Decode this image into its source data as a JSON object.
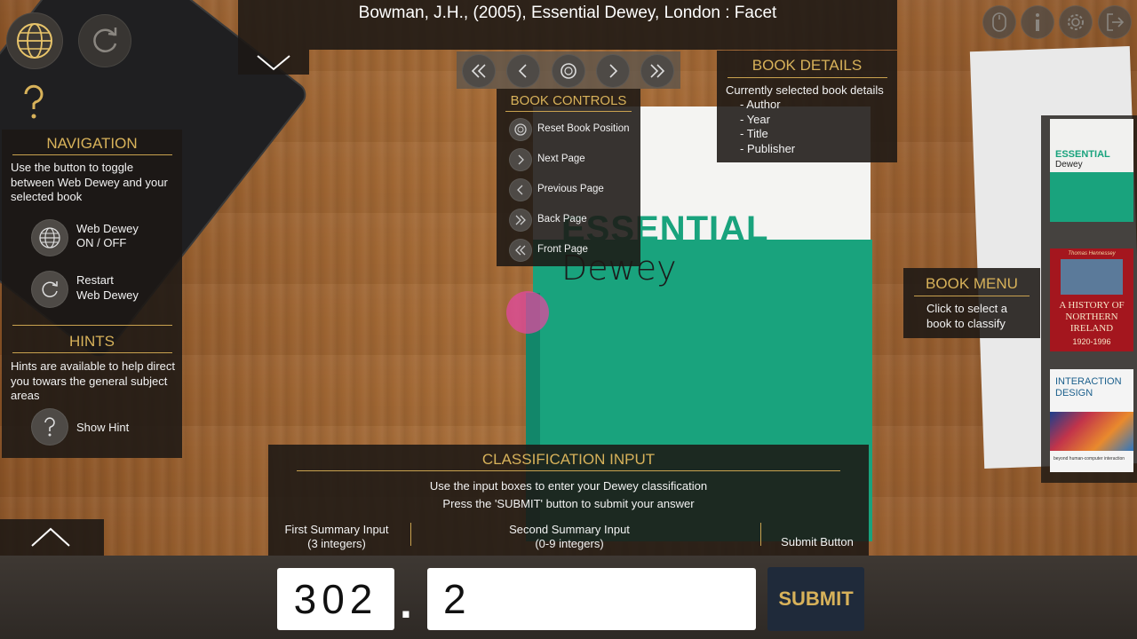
{
  "citation": "Bowman, J.H., (2005), Essential Dewey, London : Facet",
  "book_cover": {
    "title_line1": "ESSENTIAL",
    "title_line2": "Dewey"
  },
  "book_controls": {
    "title": "BOOK CONTROLS",
    "items": [
      {
        "label": "Reset Book Position",
        "icon": "reset-icon"
      },
      {
        "label": "Next Page",
        "icon": "chevron-right-icon"
      },
      {
        "label": "Previous Page",
        "icon": "chevron-left-icon"
      },
      {
        "label": "Back Page",
        "icon": "double-chevron-right-icon"
      },
      {
        "label": "Front Page",
        "icon": "double-chevron-left-icon"
      }
    ]
  },
  "book_details": {
    "title": "BOOK DETAILS",
    "intro": "Currently selected book details",
    "fields": [
      "- Author",
      "- Year",
      "- Title",
      "- Publisher"
    ]
  },
  "navigation": {
    "title": "NAVIGATION",
    "description": "Use the button to toggle between Web Dewey and your selected book",
    "web_dewey_line1": "Web Dewey",
    "web_dewey_line2": "ON / OFF",
    "restart_line1": "Restart",
    "restart_line2": "Web Dewey"
  },
  "hints": {
    "title": "HINTS",
    "description": "Hints are available to help direct you towars the general subject areas",
    "show_hint": "Show Hint"
  },
  "book_menu": {
    "title": "BOOK MENU",
    "line1": "Click to select a",
    "line2": "book to classify",
    "books": [
      {
        "title": "ESSENTIAL",
        "subtitle": "Dewey"
      },
      {
        "title": "A HISTORY OF NORTHERN IRELAND",
        "subtitle": "1920-1996",
        "author": "Thomas Hennessey"
      },
      {
        "title": "INTERACTION DESIGN",
        "subtitle": "beyond human-computer interaction"
      }
    ]
  },
  "classification": {
    "title": "CLASSIFICATION INPUT",
    "line1": "Use the input boxes to enter your Dewey classification",
    "line2": "Press the 'SUBMIT' button to submit your answer",
    "first_label_line1": "First Summary Input",
    "first_label_line2": "(3 integers)",
    "second_label_line1": "Second Summary Input",
    "second_label_line2": "(0-9 integers)",
    "submit_label": "Submit Button",
    "first_value": "302",
    "separator": ".",
    "second_value": "2",
    "submit_button": "SUBMIT"
  },
  "top_icons": [
    "globe-icon",
    "restart-icon",
    "help-icon",
    "mouse-icon",
    "info-icon",
    "gear-icon",
    "exit-icon"
  ],
  "colors": {
    "gold": "#d8b25a",
    "panel": "#1c1814",
    "book_green": "#19a37d",
    "submit_bg": "#1f2a3a"
  }
}
